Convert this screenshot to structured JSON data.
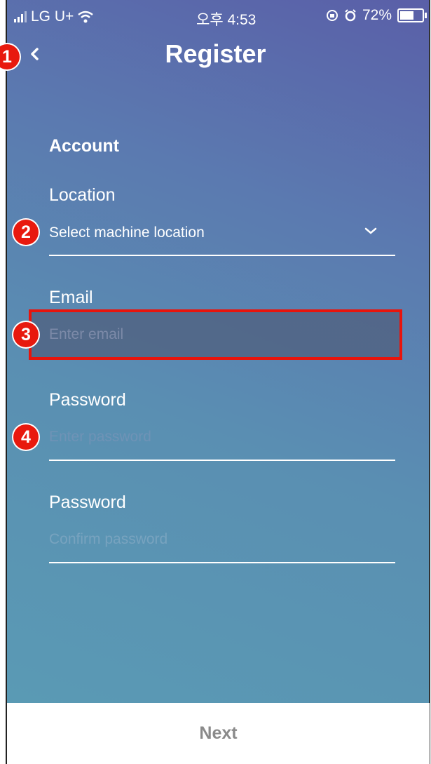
{
  "status_bar": {
    "carrier": "LG U+",
    "time": "오후 4:53",
    "battery": "72%",
    "battery_level": 0.72
  },
  "header": {
    "title": "Register"
  },
  "form": {
    "section_title": "Account",
    "location": {
      "label": "Location",
      "placeholder": "Select machine location"
    },
    "email": {
      "label": "Email",
      "placeholder": "Enter email"
    },
    "password": {
      "label": "Password",
      "placeholder": "Enter password"
    },
    "confirm_password": {
      "label": "Password",
      "placeholder": "Confirm password"
    }
  },
  "annotations": [
    "1",
    "2",
    "3",
    "4"
  ],
  "footer": {
    "next_label": "Next"
  },
  "colors": {
    "highlight": "#e8140c",
    "badge": "#e8190e",
    "gradient_top": "#5a5fa8",
    "gradient_bottom": "#5a9ab4"
  }
}
